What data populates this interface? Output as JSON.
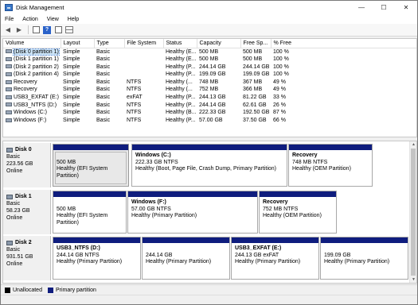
{
  "window": {
    "title": "Disk Management",
    "min": "—",
    "max": "☐",
    "close": "✕"
  },
  "menu": [
    "File",
    "Action",
    "View",
    "Help"
  ],
  "toolbar": [
    "back-icon",
    "forward-icon",
    "properties-icon",
    "help-icon",
    "console-icon",
    "grid-icon"
  ],
  "volume_table": {
    "columns": [
      "Volume",
      "Layout",
      "Type",
      "File System",
      "Status",
      "Capacity",
      "Free Sp...",
      "% Free"
    ],
    "rows": [
      [
        "(Disk 0 partition 1)",
        "Simple",
        "Basic",
        "",
        "Healthy (E...",
        "500 MB",
        "500 MB",
        "100 %"
      ],
      [
        "(Disk 1 partition 1)",
        "Simple",
        "Basic",
        "",
        "Healthy (E...",
        "500 MB",
        "500 MB",
        "100 %"
      ],
      [
        "(Disk 2 partition 2)",
        "Simple",
        "Basic",
        "",
        "Healthy (P...",
        "244.14 GB",
        "244.14 GB",
        "100 %"
      ],
      [
        "(Disk 2 partition 4)",
        "Simple",
        "Basic",
        "",
        "Healthy (P...",
        "199.09 GB",
        "199.09 GB",
        "100 %"
      ],
      [
        "Recovery",
        "Simple",
        "Basic",
        "NTFS",
        "Healthy (...",
        "748 MB",
        "367 MB",
        "49 %"
      ],
      [
        "Recovery",
        "Simple",
        "Basic",
        "NTFS",
        "Healthy (...",
        "752 MB",
        "366 MB",
        "49 %"
      ],
      [
        "USB3_EXFAT (E:)",
        "Simple",
        "Basic",
        "exFAT",
        "Healthy (P...",
        "244.13 GB",
        "81.22 GB",
        "33 %"
      ],
      [
        "USB3_NTFS (D:)",
        "Simple",
        "Basic",
        "NTFS",
        "Healthy (P...",
        "244.14 GB",
        "62.61 GB",
        "26 %"
      ],
      [
        "Windows (C:)",
        "Simple",
        "Basic",
        "NTFS",
        "Healthy (B...",
        "222.33 GB",
        "192.50 GB",
        "87 %"
      ],
      [
        "Windows (F:)",
        "Simple",
        "Basic",
        "NTFS",
        "Healthy (P...",
        "57.00 GB",
        "37.50 GB",
        "66 %"
      ]
    ]
  },
  "disks": [
    {
      "name": "Disk 0",
      "type": "Basic",
      "size": "223.56 GB",
      "status": "Online",
      "partitions": [
        {
          "name": "",
          "size": "500 MB",
          "status": "Healthy (EFI System Partition)"
        },
        {
          "name": "Windows  (C:)",
          "size": "222.33 GB NTFS",
          "status": "Healthy (Boot, Page File, Crash Dump, Primary Partition)"
        },
        {
          "name": "Recovery",
          "size": "748 MB NTFS",
          "status": "Healthy (OEM Partition)"
        }
      ]
    },
    {
      "name": "Disk 1",
      "type": "Basic",
      "size": "58.23 GB",
      "status": "Online",
      "partitions": [
        {
          "name": "",
          "size": "500 MB",
          "status": "Healthy (EFI System Partition)"
        },
        {
          "name": "Windows  (F:)",
          "size": "57.00 GB NTFS",
          "status": "Healthy (Primary Partition)"
        },
        {
          "name": "Recovery",
          "size": "752 MB NTFS",
          "status": "Healthy (OEM Partition)"
        }
      ]
    },
    {
      "name": "Disk 2",
      "type": "Basic",
      "size": "931.51 GB",
      "status": "Online",
      "partitions": [
        {
          "name": "USB3_NTFS  (D:)",
          "size": "244.14 GB NTFS",
          "status": "Healthy (Primary Partition)"
        },
        {
          "name": "",
          "size": "244.14 GB",
          "status": "Healthy (Primary Partition)"
        },
        {
          "name": "USB3_EXFAT  (E:)",
          "size": "244.13 GB exFAT",
          "status": "Healthy (Primary Partition)"
        },
        {
          "name": "",
          "size": "199.09 GB",
          "status": "Healthy (Primary Partition)"
        }
      ]
    }
  ],
  "legend": [
    {
      "label": "Unallocated",
      "color": "#000000"
    },
    {
      "label": "Primary partition",
      "color": "#0f1d7e"
    }
  ]
}
